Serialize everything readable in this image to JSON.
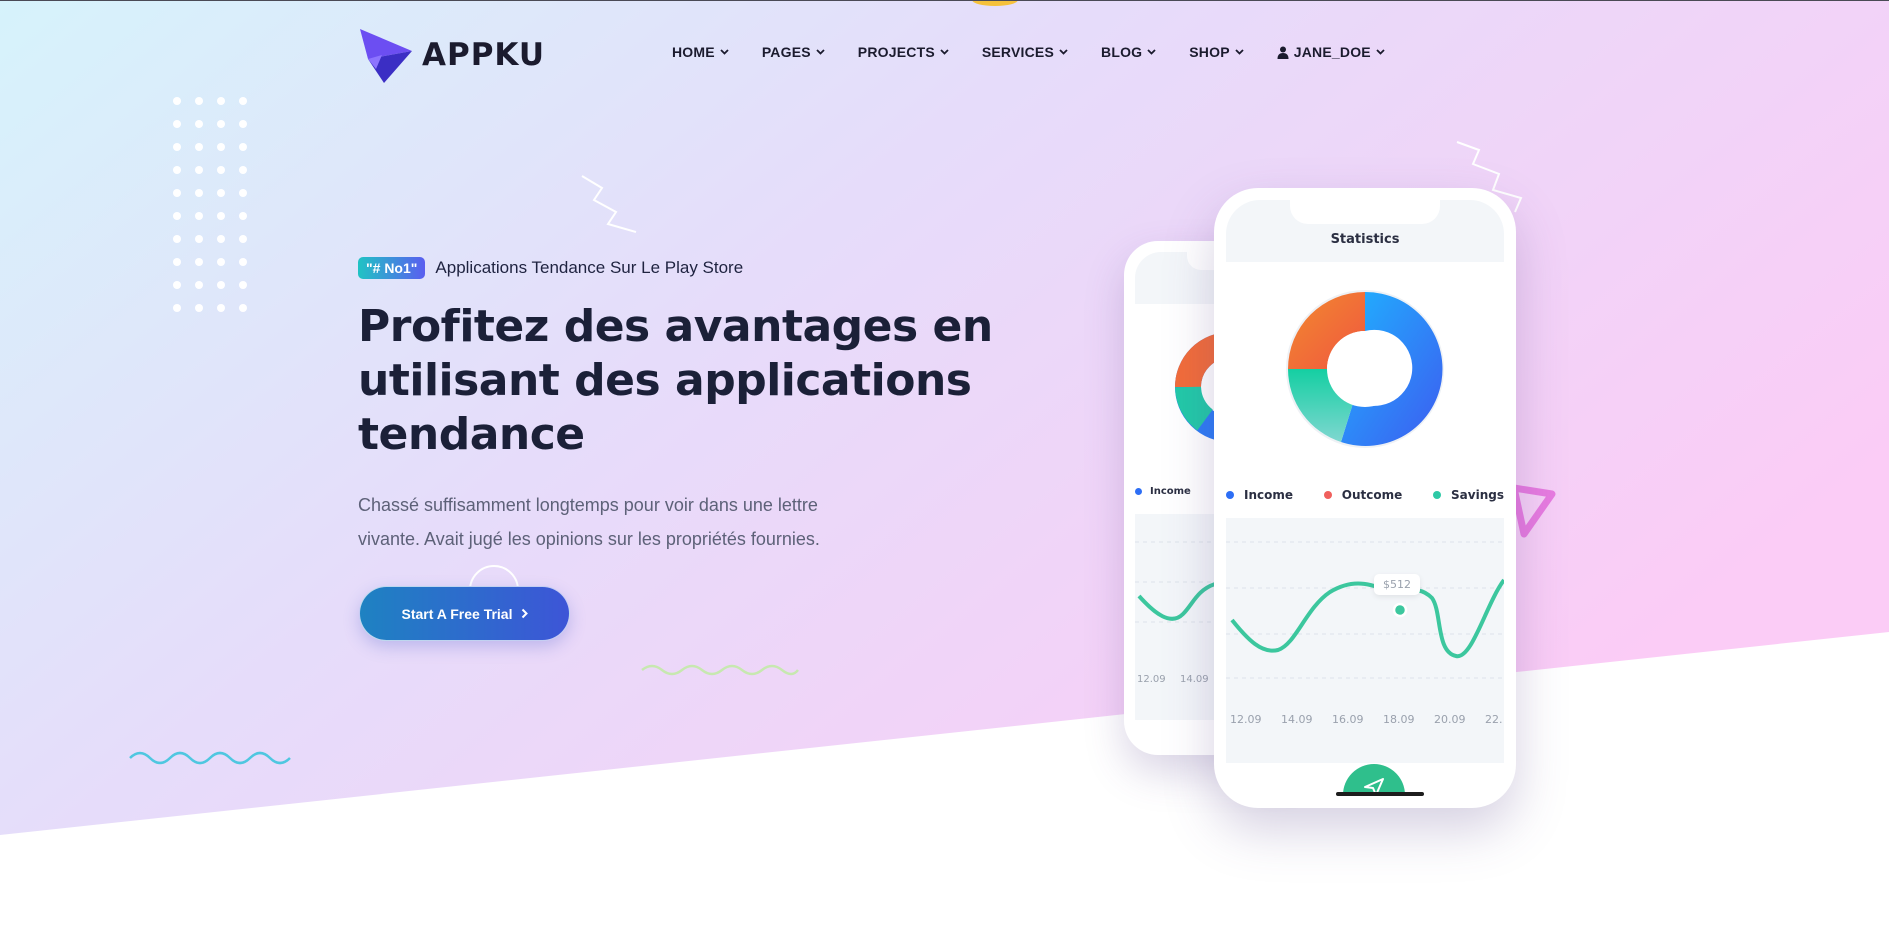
{
  "header": {
    "logo_text": "APPKU",
    "nav": [
      {
        "label": "HOME"
      },
      {
        "label": "PAGES"
      },
      {
        "label": "PROJECTS"
      },
      {
        "label": "SERVICES"
      },
      {
        "label": "BLOG"
      },
      {
        "label": "SHOP"
      },
      {
        "label": "JANE_DOE",
        "icon": "user-icon"
      }
    ]
  },
  "hero": {
    "badge": "\"# No1\"",
    "tagline": "Applications Tendance Sur Le Play Store",
    "headline": "Profitez des avantages en utilisant des applications tendance",
    "subtext": "Chassé suffisamment longtemps pour voir dans une lettre vivante. Avait jugé les opinions sur les propriétés fournies.",
    "cta_label": "Start A Free Trial"
  },
  "phone_front": {
    "title": "Statistics",
    "legend": [
      {
        "label": "Income",
        "color": "#2d6ef5"
      },
      {
        "label": "Outcome",
        "color": "#f0605d"
      },
      {
        "label": "Savings",
        "color": "#2ec9a6"
      }
    ],
    "tooltip": "$512",
    "xlabels": [
      "12.09",
      "14.09",
      "16.09",
      "18.09",
      "20.09",
      "22."
    ]
  },
  "phone_back": {
    "legend_label": "Income",
    "xlabels": [
      "12.09",
      "14.09"
    ]
  },
  "colors": {
    "accent_start": "#1e82c2",
    "accent_end": "#3d55d7",
    "donut_blue": "#2d7cf7",
    "donut_orange": "#f26c3a",
    "donut_teal": "#22c9a8",
    "line_green": "#3cc79e"
  }
}
